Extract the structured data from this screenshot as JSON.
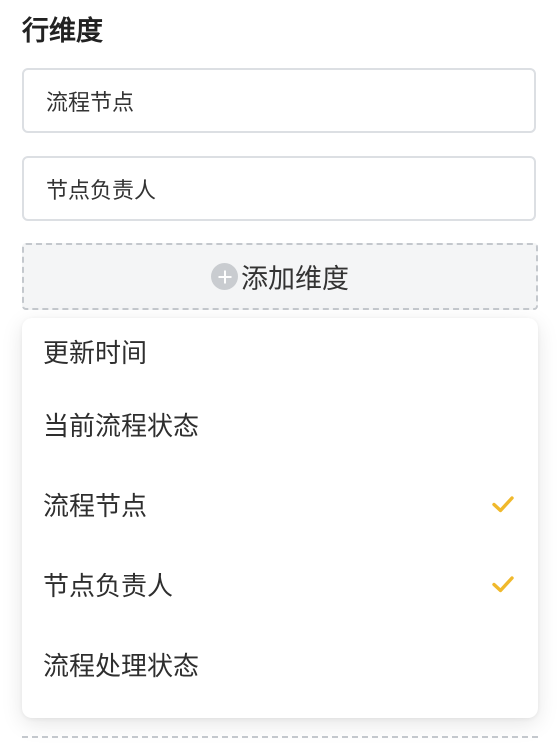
{
  "section": {
    "title": "行维度"
  },
  "dimensions": [
    {
      "label": "流程节点"
    },
    {
      "label": "节点负责人"
    }
  ],
  "add_button": {
    "label": "添加维度",
    "icon": "plus-circle-icon"
  },
  "dropdown": {
    "options": [
      {
        "label": "更新时间",
        "selected": false
      },
      {
        "label": "当前流程状态",
        "selected": false
      },
      {
        "label": "流程节点",
        "selected": true
      },
      {
        "label": "节点负责人",
        "selected": true
      },
      {
        "label": "流程处理状态",
        "selected": false
      }
    ],
    "check_color": "#f0b92c"
  }
}
